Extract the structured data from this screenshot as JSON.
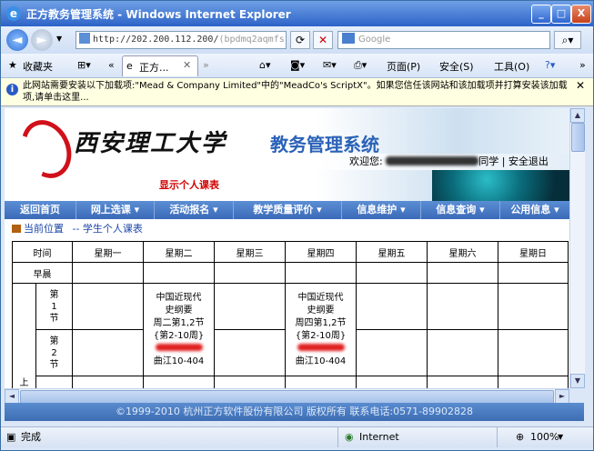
{
  "window": {
    "title": "正方教务管理系统 - Windows Internet Explorer",
    "minimize": "_",
    "restore": "□",
    "close": "X"
  },
  "address": {
    "url": "http://202.200.112.200/",
    "url_tail": "(bpdmq2aqmfs",
    "search_placeholder": "Google"
  },
  "favorites": {
    "label": "收藏夹",
    "tab_label": "正方...",
    "tools": [
      {
        "label": "页面(P)"
      },
      {
        "label": "安全(S)"
      },
      {
        "label": "工具(O)"
      }
    ]
  },
  "infobar": {
    "text": "此网站需要安装以下加载项:\"Mead & Company Limited\"中的\"MeadCo's ScriptX\"。如果您信任该网站和该加载项并打算安装该加载项,请单击这里..."
  },
  "banner": {
    "school": "西安理工大学",
    "system": "教务管理系统",
    "welcome": "欢迎您:",
    "user_suffix": "同学",
    "logout": "安全退出",
    "subtitle": "显示个人课表"
  },
  "nav": {
    "items": [
      {
        "label": "返回首页"
      },
      {
        "label": "网上选课 ▾"
      },
      {
        "label": "活动报名 ▾"
      },
      {
        "label": "教学质量评价 ▾"
      },
      {
        "label": "信息维护 ▾"
      },
      {
        "label": "信息查询 ▾"
      },
      {
        "label": "公用信息 ▾"
      }
    ]
  },
  "breadcrumb": {
    "current": "当前位置",
    "path": "-- 学生个人课表"
  },
  "schedule": {
    "headers": [
      "时间",
      "星期一",
      "星期二",
      "星期三",
      "星期四",
      "星期五",
      "星期六",
      "星期日"
    ],
    "morning_label": "早晨",
    "afternoon_label": "上午",
    "periods": [
      "第1节",
      "第2节"
    ],
    "courses": {
      "tue": {
        "line1": "中国近现代",
        "line2": "史纲要",
        "line3": "周二第1,2节",
        "line4": "{第2-10周}",
        "room": "曲江10-404"
      },
      "thu": {
        "line1": "中国近现代",
        "line2": "史纲要",
        "line3": "周四第1,2节",
        "line4": "{第2-10周}",
        "room": "曲江10-404"
      }
    }
  },
  "footer": {
    "text": "©1999-2010 杭州正方软件股份有限公司 版权所有 联系电话:0571-89902828"
  },
  "status": {
    "done": "完成",
    "zone": "Internet",
    "zoom": "100%"
  }
}
